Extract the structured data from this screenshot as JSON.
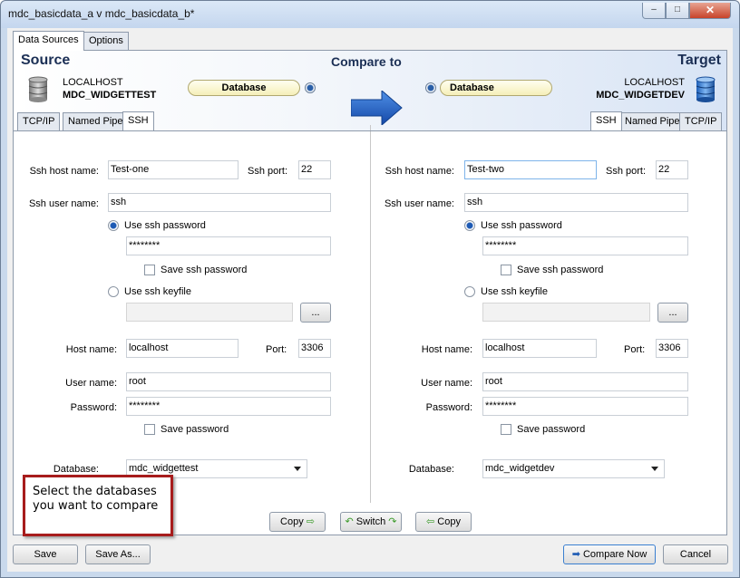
{
  "window": {
    "title": "mdc_basicdata_a v mdc_basicdata_b*",
    "controls": [
      "–",
      "□",
      "✕"
    ]
  },
  "top_tabs": [
    {
      "label": "Data Sources",
      "active": true
    },
    {
      "label": "Options",
      "active": false
    }
  ],
  "header": {
    "source_title": "Source",
    "target_title": "Target",
    "compare_label": "Compare to",
    "source_host": "LOCALHOST",
    "source_db": "MDC_WIDGETTEST",
    "target_host": "LOCALHOST",
    "target_db": "MDC_WIDGETDEV",
    "source_pill": "Database",
    "target_pill": "Database"
  },
  "source_tabs": [
    "TCP/IP",
    "Named Pipe",
    "SSH"
  ],
  "target_tabs": [
    "SSH",
    "Named Pipe",
    "TCP/IP"
  ],
  "labels": {
    "ssh_host": "Ssh host name:",
    "ssh_port": "Ssh port:",
    "ssh_user": "Ssh user name:",
    "use_ssh_password": "Use ssh password",
    "save_ssh_password": "Save ssh password",
    "use_ssh_keyfile": "Use ssh keyfile",
    "browse": "...",
    "host": "Host name:",
    "port": "Port:",
    "user": "User name:",
    "password": "Password:",
    "save_password": "Save password",
    "database": "Database:"
  },
  "source": {
    "ssh_host": "Test-one",
    "ssh_port": "22",
    "ssh_user": "ssh",
    "ssh_password": "********",
    "keyfile": "",
    "host": "localhost",
    "port": "3306",
    "user": "root",
    "password": "********",
    "database": "mdc_widgettest"
  },
  "target": {
    "ssh_host": "Test-two",
    "ssh_port": "22",
    "ssh_user": "ssh",
    "ssh_password": "********",
    "keyfile": "",
    "host": "localhost",
    "port": "3306",
    "user": "root",
    "password": "********",
    "database": "mdc_widgetdev"
  },
  "callout": "Select the databases you want to compare",
  "mid_buttons": {
    "copy_right": "Copy",
    "switch": "Switch",
    "copy_left": "Copy"
  },
  "bottom": {
    "save": "Save",
    "save_as": "Save As...",
    "compare_now": "Compare Now",
    "cancel": "Cancel"
  }
}
